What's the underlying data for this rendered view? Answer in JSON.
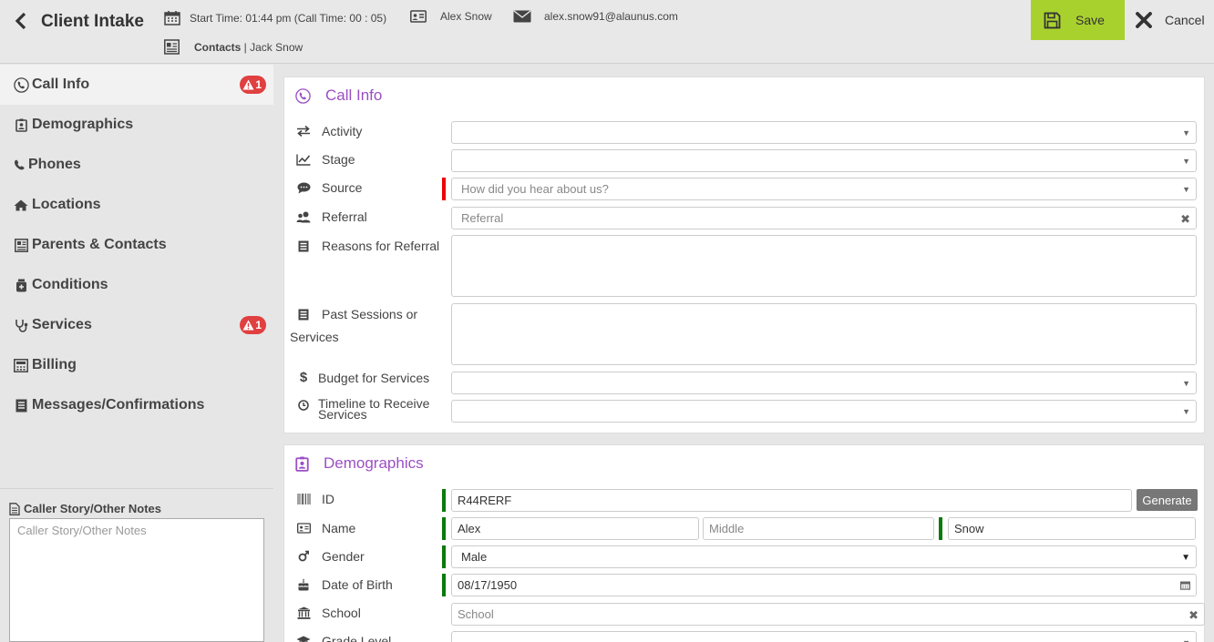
{
  "header": {
    "title": "Client Intake",
    "start_time": "Start Time: 01:44 pm (Call Time: 00 : 05)",
    "client_name": "Alex Snow",
    "email": "alex.snow91@alaunus.com",
    "contacts_label": "Contacts",
    "contacts_value": " | Jack Snow",
    "save_label": "Save",
    "cancel_label": "Cancel"
  },
  "sidebar": {
    "items": [
      {
        "label": "Call Info",
        "icon": "phone-icon",
        "badge": "1"
      },
      {
        "label": "Demographics",
        "icon": "id-badge-icon"
      },
      {
        "label": "Phones",
        "icon": "phone-handset-icon"
      },
      {
        "label": "Locations",
        "icon": "home-icon"
      },
      {
        "label": "Parents & Contacts",
        "icon": "contact-card-icon"
      },
      {
        "label": "Conditions",
        "icon": "medkit-icon"
      },
      {
        "label": "Services",
        "icon": "stethoscope-icon",
        "badge": "1"
      },
      {
        "label": "Billing",
        "icon": "calculator-icon"
      },
      {
        "label": "Messages/Confirmations",
        "icon": "list-icon"
      }
    ],
    "notes_title": "Caller Story/Other Notes",
    "notes_placeholder": "Caller Story/Other Notes"
  },
  "call_info": {
    "title": "Call Info",
    "activity_label": "Activity",
    "stage_label": "Stage",
    "source_label": "Source",
    "source_placeholder": "How did you hear about us?",
    "referral_label": "Referral",
    "referral_placeholder": "Referral",
    "reasons_label": "Reasons for Referral",
    "past_label_1": "Past Sessions or",
    "past_label_2": "Services",
    "budget_label": "Budget for Services",
    "timeline_label_1": "Timeline to Receive",
    "timeline_label_2": "Services"
  },
  "demographics": {
    "title": "Demographics",
    "id_label": "ID",
    "id_value": "R44RERF",
    "generate_label": "Generate",
    "name_label": "Name",
    "first_name": "Alex",
    "middle_placeholder": "Middle",
    "last_name": "Snow",
    "gender_label": "Gender",
    "gender_value": "Male",
    "dob_label": "Date of Birth",
    "dob_value": "08/17/1950",
    "school_label": "School",
    "school_placeholder": "School",
    "grade_label": "Grade Level"
  },
  "colors": {
    "accent_purple": "#9b4fc5",
    "save_green": "#a9d12e",
    "badge_red": "#e04040",
    "required_red": "#ee0000",
    "required_green": "#0a7a0a"
  }
}
